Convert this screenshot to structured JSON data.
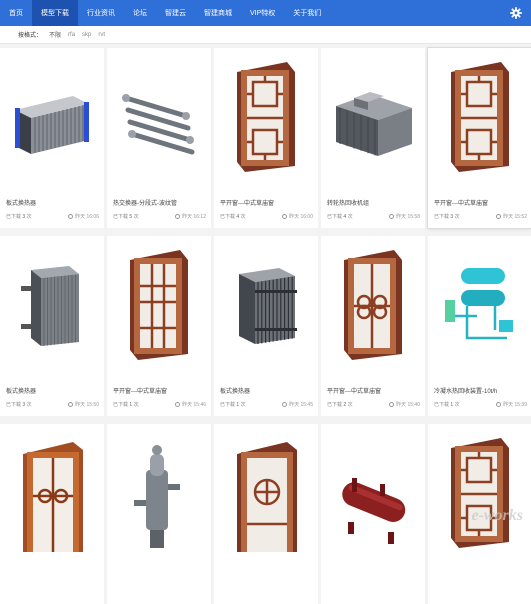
{
  "nav": {
    "items": [
      "首页",
      "模型下载",
      "行业资讯",
      "论坛",
      "智建云",
      "智建商城",
      "VIP特权",
      "关于我们"
    ],
    "active_index": 1
  },
  "filter": {
    "label": "按格式：",
    "options": [
      "不限",
      "rfa",
      "skp",
      "rvt"
    ]
  },
  "cards": [
    {
      "name": "板式换热器",
      "dl_label": "已下载",
      "dl_count": "3",
      "dl_unit": "次",
      "time": "昨天 16:06",
      "icon": "plate-exchanger-icon"
    },
    {
      "name": "热交换器-分段式-波纹管",
      "dl_label": "已下载",
      "dl_count": "5",
      "dl_unit": "次",
      "time": "昨天 16:12",
      "icon": "tube-exchanger-icon"
    },
    {
      "name": "平开窗---中式草庙窗",
      "dl_label": "已下载",
      "dl_count": "4",
      "dl_unit": "次",
      "time": "昨天 16:00",
      "icon": "chinese-window-icon"
    },
    {
      "name": "转轮热回收机组",
      "dl_label": "已下载",
      "dl_count": "4",
      "dl_unit": "次",
      "time": "昨天 15:58",
      "icon": "heat-recovery-unit-icon"
    },
    {
      "name": "平开窗---中式草庙窗",
      "dl_label": "已下载",
      "dl_count": "3",
      "dl_unit": "次",
      "time": "昨天 15:52",
      "icon": "chinese-window-icon"
    },
    {
      "name": "板式换热器",
      "dl_label": "已下载",
      "dl_count": "3",
      "dl_unit": "次",
      "time": "昨天 15:50",
      "icon": "plate-exchanger-gray-icon"
    },
    {
      "name": "平开窗---中式草庙窗",
      "dl_label": "已下载",
      "dl_count": "1",
      "dl_unit": "次",
      "time": "昨天 15:46",
      "icon": "window-grid-icon"
    },
    {
      "name": "板式换热器",
      "dl_label": "已下载",
      "dl_count": "1",
      "dl_unit": "次",
      "time": "昨天 15:45",
      "icon": "plate-exchanger-frame-icon"
    },
    {
      "name": "平开窗---中式草庙窗",
      "dl_label": "已下载",
      "dl_count": "2",
      "dl_unit": "次",
      "time": "昨天 15:40",
      "icon": "window-round-icon"
    },
    {
      "name": "冷凝水热回收装置-10t/h",
      "dl_label": "已下载",
      "dl_count": "1",
      "dl_unit": "次",
      "time": "昨天 15:39",
      "icon": "condensate-recovery-icon"
    },
    {
      "name": "",
      "dl_label": "",
      "dl_count": "",
      "dl_unit": "",
      "time": "",
      "icon": "wood-window-icon"
    },
    {
      "name": "",
      "dl_label": "",
      "dl_count": "",
      "dl_unit": "",
      "time": "",
      "icon": "deaerator-icon"
    },
    {
      "name": "",
      "dl_label": "",
      "dl_count": "",
      "dl_unit": "",
      "time": "",
      "icon": "window-circle-icon"
    },
    {
      "name": "",
      "dl_label": "",
      "dl_count": "",
      "dl_unit": "",
      "time": "",
      "icon": "red-tank-icon"
    },
    {
      "name": "",
      "dl_label": "",
      "dl_count": "",
      "dl_unit": "",
      "time": "",
      "icon": "chinese-window-icon"
    }
  ],
  "watermark": {
    "text": "e-works"
  },
  "colors": {
    "nav": "#2f6fd8",
    "nav_active": "#1e52b0",
    "wood": "#a0522d",
    "steel": "#6e737a"
  }
}
